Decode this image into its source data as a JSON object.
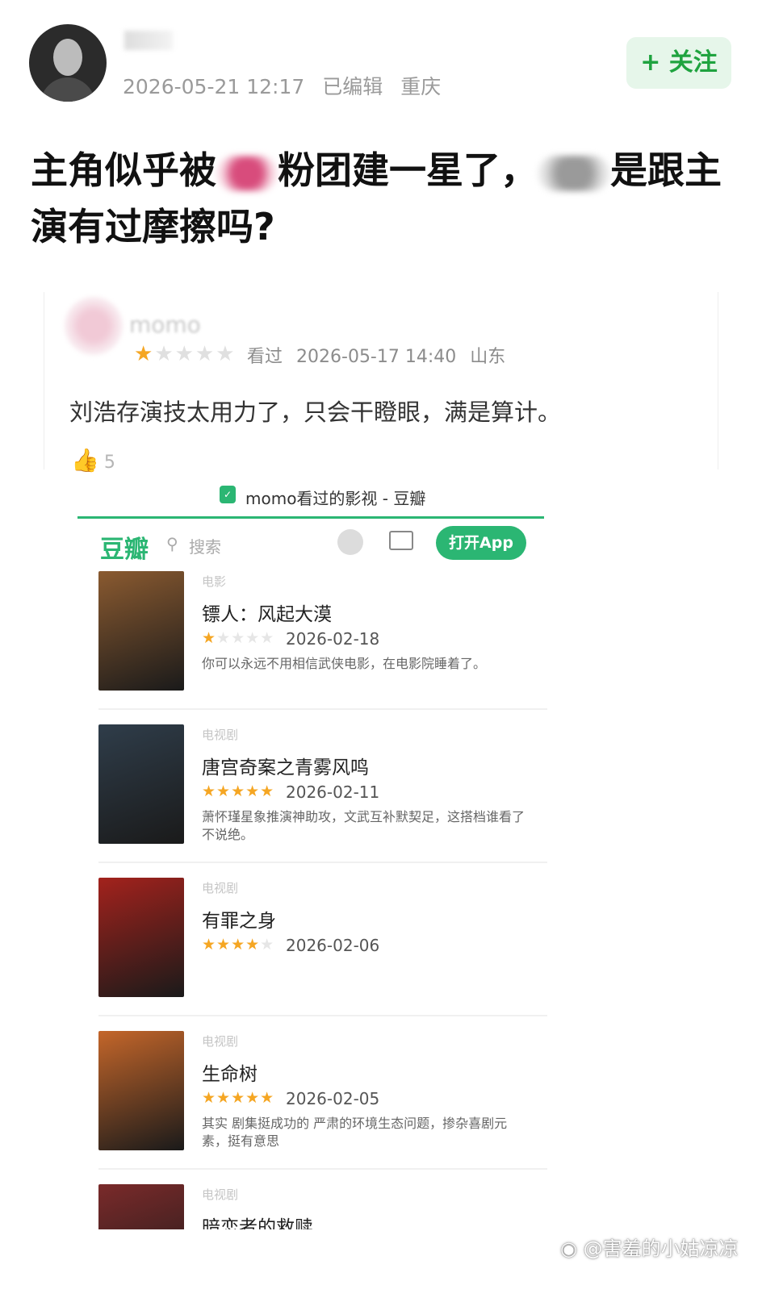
{
  "post": {
    "username": "",
    "timestamp": "2026-05-21 12:17",
    "edited": "已编辑",
    "location": "重庆",
    "follow_label": "+ 关注",
    "text_part1": "主角似乎被",
    "text_part2": "粉团建一星了，",
    "text_part3": "是跟主演有过摩擦吗?"
  },
  "comment": {
    "username": "momo",
    "rating": 1,
    "status": "看过",
    "timestamp": "2026-05-17 14:40",
    "location": "山东",
    "text": "刘浩存演技太用力了，只会干瞪眼，满是算计。",
    "likes": "5"
  },
  "douban": {
    "tab_title": "momo看过的影视 - 豆瓣",
    "logo": "豆瓣",
    "search_placeholder": "搜索",
    "open_app_label": "打开App",
    "items": [
      {
        "type": "电影",
        "title": "镖人：风起大漠",
        "rating": 1,
        "date": "2026-02-18",
        "comment": "你可以永远不用相信武侠电影，在电影院睡着了。",
        "poster_color": "#8a5a30"
      },
      {
        "type": "电视剧",
        "title": "唐宫奇案之青雾风鸣",
        "rating": 5,
        "date": "2026-02-11",
        "comment": "萧怀瑾星象推演神助攻，文武互补默契足，这搭档谁看了不说绝。",
        "poster_color": "#2f3d4a"
      },
      {
        "type": "电视剧",
        "title": "有罪之身",
        "rating": 4,
        "date": "2026-02-06",
        "comment": "",
        "poster_color": "#a3221c"
      },
      {
        "type": "电视剧",
        "title": "生命树",
        "rating": 5,
        "date": "2026-02-05",
        "comment": "其实 剧集挺成功的 严肃的环境生态问题，掺杂喜剧元素，挺有意思",
        "poster_color": "#c4662a"
      },
      {
        "type": "电视剧",
        "title": "暗恋者的救赎",
        "rating": 0,
        "date": "",
        "comment": "",
        "poster_color": "#7a2a2a"
      }
    ]
  },
  "watermark": "@害羞的小姑凉凉",
  "colors": {
    "accent": "#2bb673",
    "follow_bg": "#e6f6ea",
    "follow_text": "#1fa33f",
    "star": "#f5a623"
  }
}
